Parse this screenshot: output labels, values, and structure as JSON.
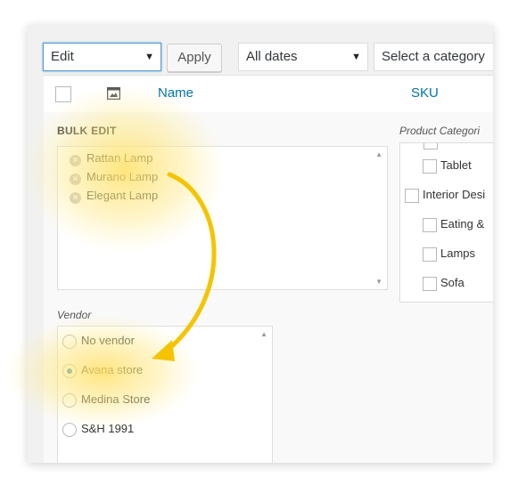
{
  "toolbar": {
    "bulk_action": "Edit",
    "apply_label": "Apply",
    "dates_filter": "All dates",
    "category_filter": "Select a category"
  },
  "table_header": {
    "name_col": "Name",
    "sku_col": "SKU",
    "image_icon": "image-icon"
  },
  "bulk_edit": {
    "title": "BULK EDIT",
    "items": [
      "Rattan Lamp",
      "Murano Lamp",
      "Elegant Lamp"
    ],
    "remove_icon": "remove-circle-icon"
  },
  "categories": {
    "title": "Product Categori",
    "items": [
      "Tablet",
      "Interior Desi",
      "Eating &",
      "Lamps",
      "Sofa"
    ]
  },
  "vendor": {
    "title": "Vendor",
    "options": [
      "No vendor",
      "Avana store",
      "Medina Store",
      "S&H 1991"
    ],
    "selected": "Avana store"
  },
  "annotation": {
    "highlight_color": "#ffe066",
    "arrow_color": "#f5c400",
    "arrow_icon": "curved-arrow-icon"
  }
}
